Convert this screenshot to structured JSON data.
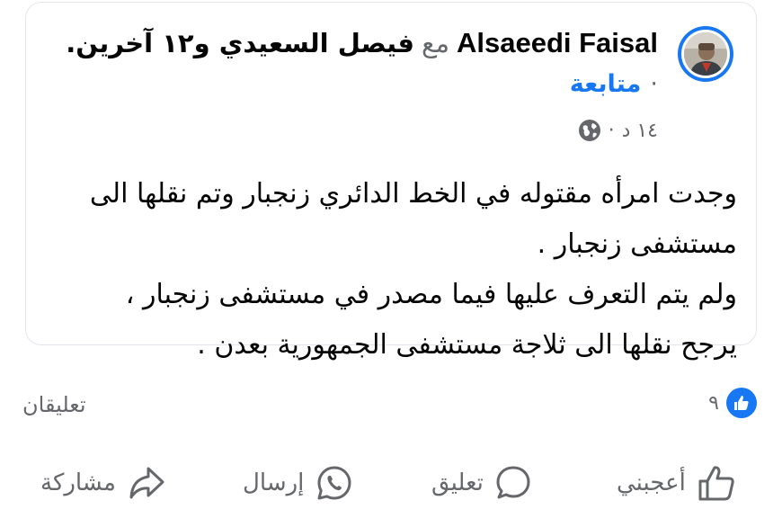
{
  "post": {
    "author": "Alsaeedi Faisal",
    "with_text": "مع",
    "tagged_text": "فيصل السعيدي و١٢ آخرين",
    "tagged_end": ".",
    "follow_dot": "·",
    "follow_label": "متابعة",
    "time": "١٤ د",
    "time_sep": "·",
    "privacy_icon": "globe-icon",
    "body_lines": [
      "وجدت امرأه مقتوله في الخط الدائري زنجبار وتم نقلها الى",
      "مستشفى زنجبار .",
      "ولم يتم التعرف عليها  فيما مصدر في مستشفى زنجبار ،",
      "يرجح نقلها الى ثلاجة مستشفى الجمهورية بعدن ."
    ]
  },
  "stats": {
    "reaction_count": "٩",
    "reaction_icon": "like-icon",
    "comments": "تعليقان"
  },
  "actions": {
    "like": "أعجبني",
    "comment": "تعليق",
    "send": "إرسال",
    "share": "مشاركة"
  },
  "colors": {
    "accent": "#1877f2",
    "secondary_text": "#65676b",
    "primary_text": "#050505",
    "card_border": "#e4e6eb"
  }
}
